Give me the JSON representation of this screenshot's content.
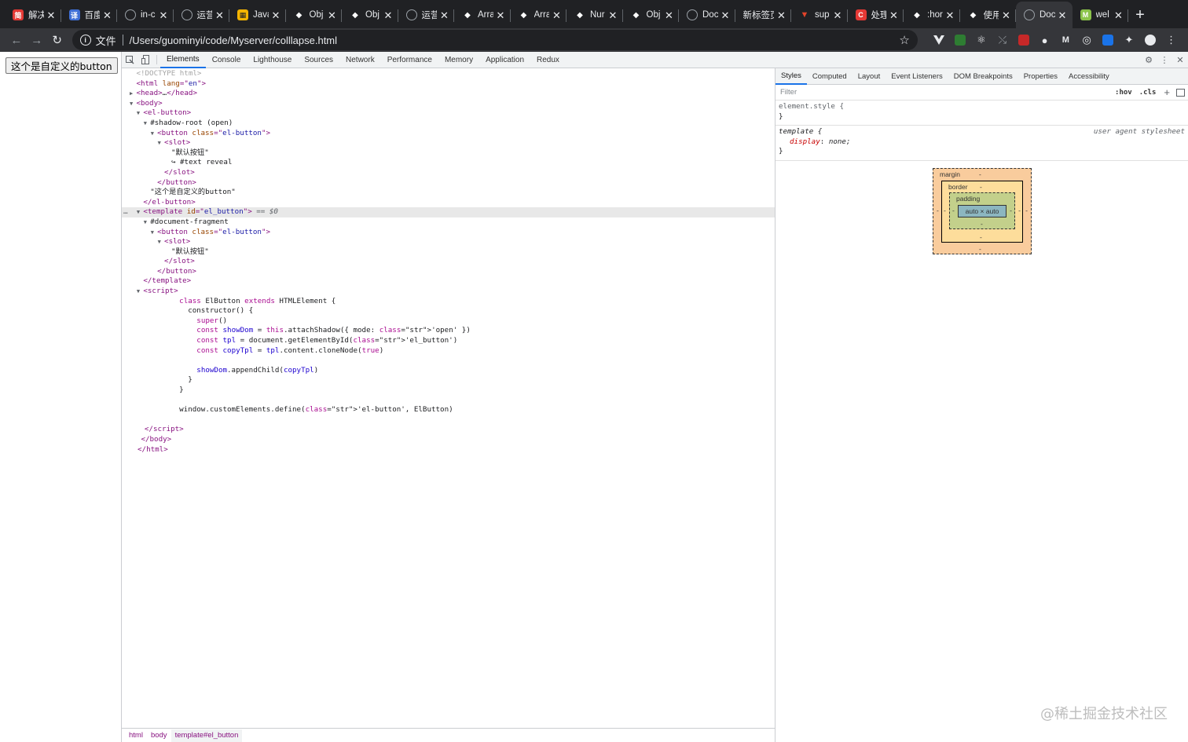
{
  "browser": {
    "tabs": [
      {
        "title": "解决",
        "favicon_color": "#e53935",
        "favicon_glyph": "简"
      },
      {
        "title": "百度",
        "favicon_color": "#3f6fd6",
        "favicon_glyph": "译"
      },
      {
        "title": "in-c",
        "favicon_color": "#5f6368",
        "favicon_glyph": "globe"
      },
      {
        "title": "运营",
        "favicon_color": "#5f6368",
        "favicon_glyph": "globe"
      },
      {
        "title": "Java",
        "favicon_color": "#f4b400",
        "favicon_glyph": "grid"
      },
      {
        "title": "Obj",
        "favicon_color": "#202124",
        "favicon_glyph": "mdn"
      },
      {
        "title": "Obj",
        "favicon_color": "#202124",
        "favicon_glyph": "mdn"
      },
      {
        "title": "运营",
        "favicon_color": "#5f6368",
        "favicon_glyph": "globe"
      },
      {
        "title": "Arra",
        "favicon_color": "#202124",
        "favicon_glyph": "mdn"
      },
      {
        "title": "Arra",
        "favicon_color": "#202124",
        "favicon_glyph": "mdn"
      },
      {
        "title": "Nur",
        "favicon_color": "#202124",
        "favicon_glyph": "mdn"
      },
      {
        "title": "Obj",
        "favicon_color": "#202124",
        "favicon_glyph": "mdn"
      },
      {
        "title": "Doc",
        "favicon_color": "#5f6368",
        "favicon_glyph": "globe"
      },
      {
        "title": "新标签页",
        "favicon_color": "#202124",
        "favicon_glyph": ""
      },
      {
        "title": "sup",
        "favicon_color": "#e2432a",
        "favicon_glyph": "gitlab"
      },
      {
        "title": "处理",
        "favicon_color": "#e53935",
        "favicon_glyph": "C"
      },
      {
        "title": ":hor",
        "favicon_color": "#202124",
        "favicon_glyph": "mdn"
      },
      {
        "title": "使用",
        "favicon_color": "#202124",
        "favicon_glyph": "mdn"
      },
      {
        "title": "Doc",
        "favicon_color": "#5f6368",
        "favicon_glyph": "globe",
        "active": true
      },
      {
        "title": "wel",
        "favicon_color": "#8bc34a",
        "favicon_glyph": "M"
      }
    ],
    "new_tab": "+",
    "address": {
      "scheme_label": "文件",
      "url": "/Users/guominyi/code/Myserver/colllapse.html"
    }
  },
  "page": {
    "button_text": "这个是自定义的button"
  },
  "devtools": {
    "tabs": [
      "Elements",
      "Console",
      "Lighthouse",
      "Sources",
      "Network",
      "Performance",
      "Memory",
      "Application",
      "Redux"
    ],
    "active_tab": "Elements",
    "tree": [
      {
        "indent": 0,
        "tri": "",
        "kind": "comment",
        "text": "<!DOCTYPE html>"
      },
      {
        "indent": 0,
        "tri": "",
        "kind": "tag",
        "open": "html",
        "attrs": [
          [
            "lang",
            "en"
          ]
        ],
        "close": ""
      },
      {
        "indent": 0,
        "tri": "▶",
        "kind": "collapsed",
        "open": "head",
        "ellipsis": "…",
        "close": "head"
      },
      {
        "indent": 0,
        "tri": "▼",
        "kind": "tag",
        "open": "body",
        "attrs": [],
        "close": ""
      },
      {
        "indent": 1,
        "tri": "▼",
        "kind": "tag",
        "open": "el-button",
        "attrs": [],
        "close": ""
      },
      {
        "indent": 2,
        "tri": "▼",
        "kind": "text",
        "text": "#shadow-root (open)"
      },
      {
        "indent": 3,
        "tri": "▼",
        "kind": "tag",
        "open": "button",
        "attrs": [
          [
            "class",
            "el-button"
          ]
        ],
        "close": ""
      },
      {
        "indent": 4,
        "tri": "▼",
        "kind": "tag",
        "open": "slot",
        "attrs": [],
        "close": ""
      },
      {
        "indent": 5,
        "tri": "",
        "kind": "text",
        "text": "\"默认按钮\""
      },
      {
        "indent": 5,
        "tri": "",
        "kind": "text",
        "text": "↪ #text reveal"
      },
      {
        "indent": 4,
        "tri": "",
        "kind": "endtag",
        "close": "slot"
      },
      {
        "indent": 3,
        "tri": "",
        "kind": "endtag",
        "close": "button"
      },
      {
        "indent": 2,
        "tri": "",
        "kind": "text",
        "text": "\"这个是自定义的button\""
      },
      {
        "indent": 1,
        "tri": "",
        "kind": "endtag",
        "close": "el-button"
      },
      {
        "indent": 1,
        "tri": "▼",
        "kind": "tag",
        "open": "template",
        "attrs": [
          [
            "id",
            "el_button"
          ]
        ],
        "close": "",
        "selected": true,
        "suffix": " == $0"
      },
      {
        "indent": 2,
        "tri": "▼",
        "kind": "text",
        "text": "#document-fragment"
      },
      {
        "indent": 3,
        "tri": "▼",
        "kind": "tag",
        "open": "button",
        "attrs": [
          [
            "class",
            "el-button"
          ]
        ],
        "close": ""
      },
      {
        "indent": 4,
        "tri": "▼",
        "kind": "tag",
        "open": "slot",
        "attrs": [],
        "close": ""
      },
      {
        "indent": 5,
        "tri": "",
        "kind": "text",
        "text": "\"默认按钮\""
      },
      {
        "indent": 4,
        "tri": "",
        "kind": "endtag",
        "close": "slot"
      },
      {
        "indent": 3,
        "tri": "",
        "kind": "endtag",
        "close": "button"
      },
      {
        "indent": 1,
        "tri": "",
        "kind": "endtag",
        "close": "template"
      },
      {
        "indent": 1,
        "tri": "▼",
        "kind": "tag",
        "open": "script",
        "attrs": [],
        "close": ""
      }
    ],
    "script_lines": [
      "        class ElButton extends HTMLElement {",
      "          constructor() {",
      "            super()",
      "            const showDom = this.attachShadow({ mode: 'open' })",
      "            const tpl = document.getElementById('el_button')",
      "            const copyTpl = tpl.content.cloneNode(true)",
      "",
      "            showDom.appendChild(copyTpl)",
      "          }",
      "        }",
      "",
      "        window.customElements.define('el-button', ElButton)",
      ""
    ],
    "tree_tail": [
      {
        "indent": 1,
        "kind": "endtag",
        "close": "script"
      },
      {
        "indent": 0.5,
        "kind": "endtag",
        "close": "body"
      },
      {
        "indent": 0,
        "kind": "endtag",
        "close": "html"
      }
    ],
    "breadcrumbs": [
      "html",
      "body",
      "template#el_button"
    ],
    "styles": {
      "tabs": [
        "Styles",
        "Computed",
        "Layout",
        "Event Listeners",
        "DOM Breakpoints",
        "Properties",
        "Accessibility"
      ],
      "active_tab": "Styles",
      "filter_placeholder": "Filter",
      "hov": ":hov",
      "cls": ".cls",
      "element_style_selector": "element.style {",
      "close_brace": "}",
      "ua_selector": "template {",
      "ua_source": "user agent stylesheet",
      "ua_prop": "display",
      "ua_value": "none;"
    },
    "boxmodel": {
      "margin_label": "margin",
      "border_label": "border",
      "padding_label": "padding",
      "content": "auto × auto",
      "dash": "-"
    }
  },
  "watermark": "@稀土掘金技术社区"
}
